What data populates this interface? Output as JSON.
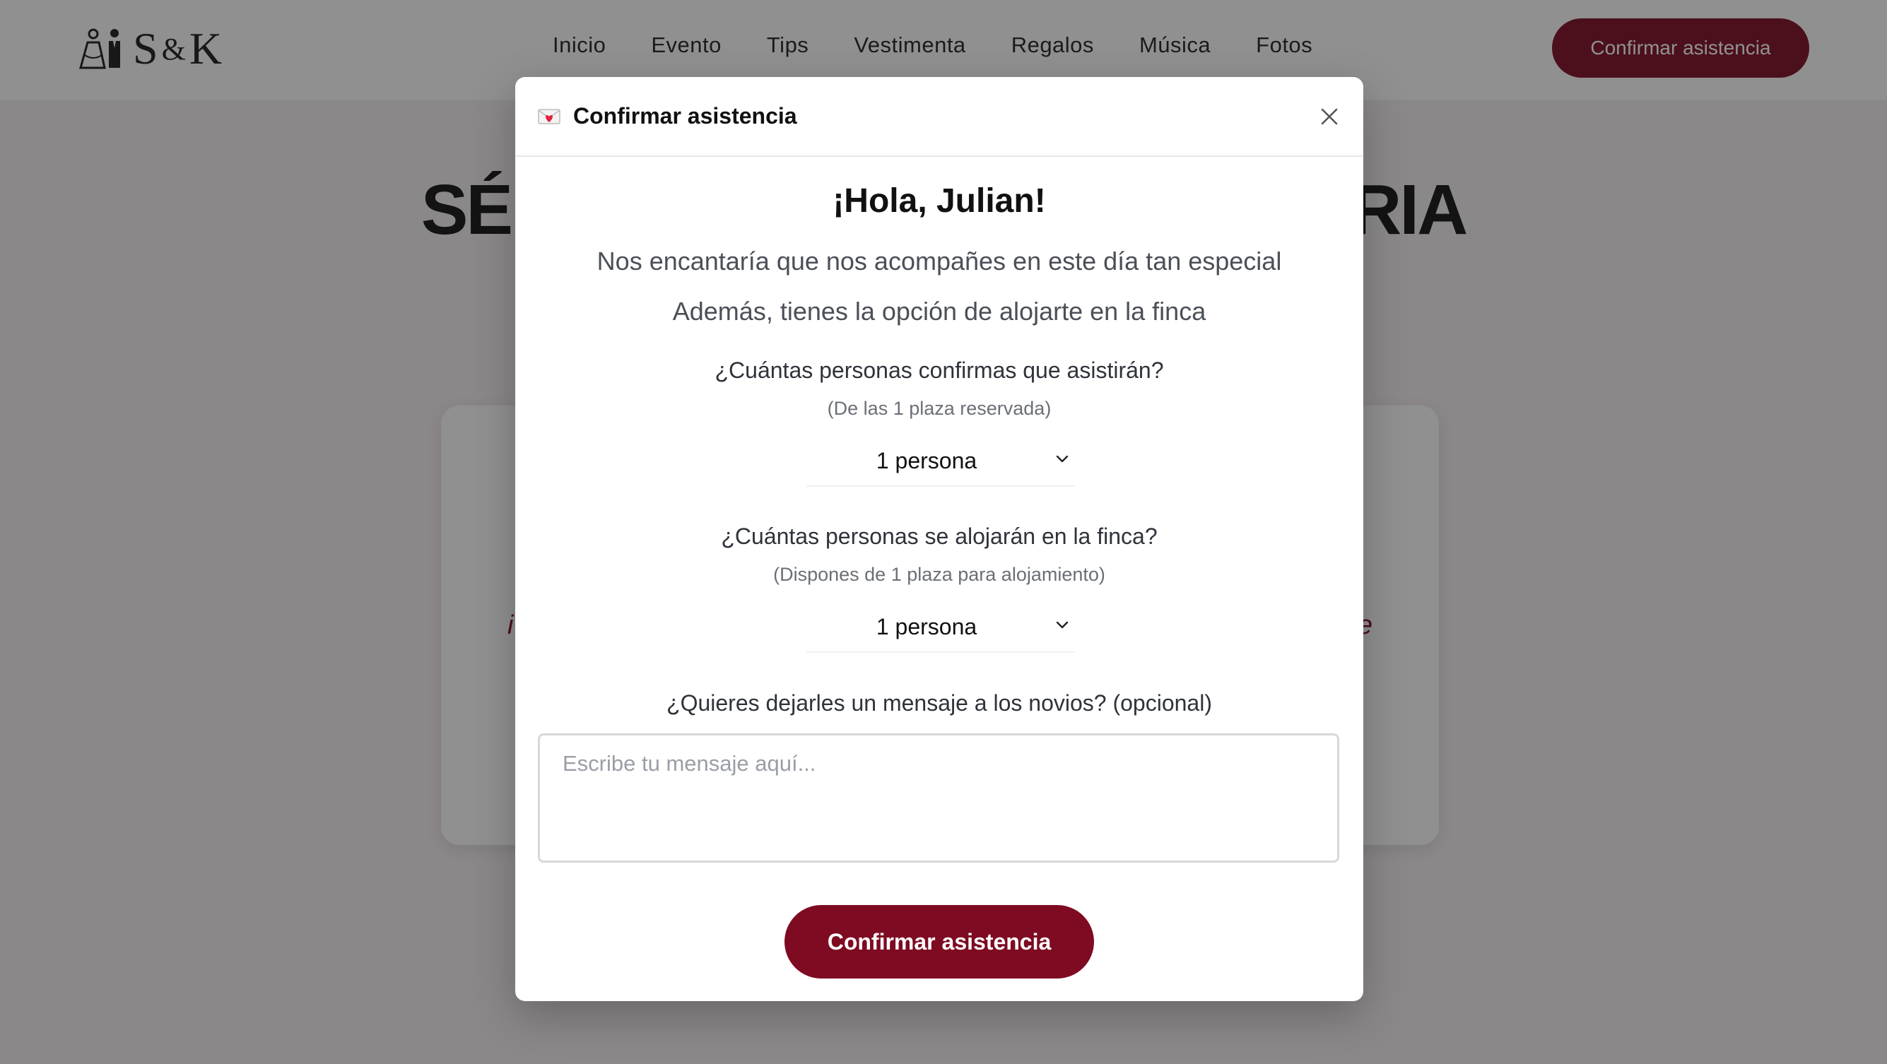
{
  "navbar": {
    "logo_text": "S",
    "logo_amp": "&",
    "logo_text_2": "K",
    "links": [
      "Inicio",
      "Evento",
      "Tips",
      "Vestimenta",
      "Regalos",
      "Música",
      "Fotos"
    ],
    "cta_label": "Confirmar asistencia"
  },
  "hero": {
    "title_left": "SÉ",
    "title_right": "RIA"
  },
  "bg_card": {
    "left_fragment": "i",
    "right_fragment": "e"
  },
  "modal": {
    "title": "Confirmar asistencia",
    "greeting": "¡Hola, Julian!",
    "intro_1": "Nos encantaría que nos acompañes en este día tan especial",
    "intro_2": "Además, tienes la opción de alojarte en la finca",
    "attendance_question": "¿Cuántas personas confirmas que asistirán?",
    "attendance_hint": "(De las 1 plaza reservada)",
    "attendance_value": "1 persona",
    "lodging_question": "¿Cuántas personas se alojarán en la finca?",
    "lodging_hint": "(Dispones de 1 plaza para alojamiento)",
    "lodging_value": "1 persona",
    "message_question": "¿Quieres dejarles un mensaje a los novios? (opcional)",
    "message_placeholder": "Escribe tu mensaje aquí...",
    "submit_label": "Confirmar asistencia"
  },
  "colors": {
    "brand": "#7e0b22",
    "overlay": "rgba(24,24,24,0.48)"
  },
  "icons": {
    "logo": "bride-groom-icon",
    "modal_title": "love-letter-icon",
    "close": "close-icon",
    "select": "chevron-down-icon"
  }
}
